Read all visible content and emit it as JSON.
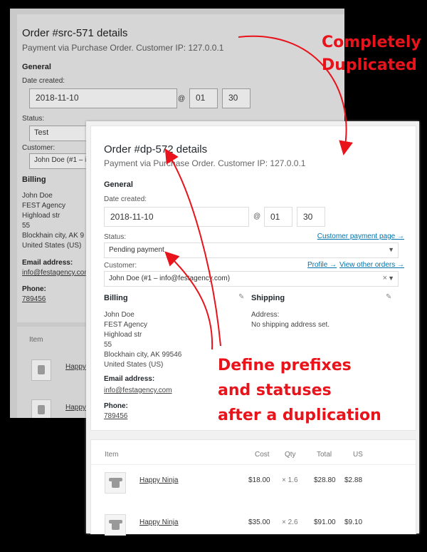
{
  "original": {
    "title": "Order #src-571 details",
    "subtitle": "Payment via Purchase Order. Customer IP: 127.0.0.1",
    "section_general": "General",
    "date_label": "Date created:",
    "date_value": "2018-11-10",
    "at_symbol": "@",
    "hour": "01",
    "minute": "30",
    "status_label": "Status:",
    "status_value": "Test",
    "customer_label": "Customer:",
    "customer_value": "John Doe (#1 – in",
    "billing_heading": "Billing",
    "billing_lines": [
      "John Doe",
      "FEST Agency",
      "Highload str",
      "55",
      "Blockhain city, AK 9",
      "United States (US)"
    ],
    "email_label": "Email address:",
    "email_value": "info@festagency.com",
    "phone_label": "Phone:",
    "phone_value": "789456",
    "item_header": "Item",
    "item_links": [
      "Happy",
      "Happy"
    ]
  },
  "duplicate": {
    "title": "Order #dp-572 details",
    "subtitle": "Payment via Purchase Order. Customer IP: 127.0.0.1",
    "section_general": "General",
    "date_label": "Date created:",
    "date_value": "2018-11-10",
    "at_symbol": "@",
    "hour": "01",
    "minute": "30",
    "status_label": "Status:",
    "customer_payment_link": "Customer payment page →",
    "status_value": "Pending payment",
    "customer_label": "Customer:",
    "profile_link": "Profile →",
    "orders_link": "View other orders →",
    "customer_value": "John Doe (#1 – info@festagency.com)",
    "clear_symbol": "×",
    "billing_heading": "Billing",
    "billing_lines": [
      "John Doe",
      "FEST Agency",
      "Highload str",
      "55",
      "Blockhain city, AK 99546",
      "United States (US)"
    ],
    "email_label": "Email address:",
    "email_value": "info@festagency.com",
    "phone_label": "Phone:",
    "phone_value": "789456",
    "shipping_heading": "Shipping",
    "address_label": "Address:",
    "address_value": "No shipping address set.",
    "table": {
      "headers": [
        "Item",
        "Cost",
        "Qty",
        "Total",
        "US"
      ],
      "rows": [
        {
          "name": "Happy Ninja",
          "cost": "$18.00",
          "qty": "× 1.6",
          "total": "$28.80",
          "tax": "$2.88"
        },
        {
          "name": "Happy Ninja",
          "cost": "$35.00",
          "qty": "× 2.6",
          "total": "$91.00",
          "tax": "$9.10"
        }
      ]
    }
  },
  "annotations": {
    "top_callout": [
      "Completely",
      "Duplicated"
    ],
    "bottom_callout": [
      "Define prefixes",
      "and statuses",
      "after a duplication"
    ],
    "color": "#e8131b"
  },
  "icons": {
    "pencil": "✎",
    "caret": "▼"
  }
}
